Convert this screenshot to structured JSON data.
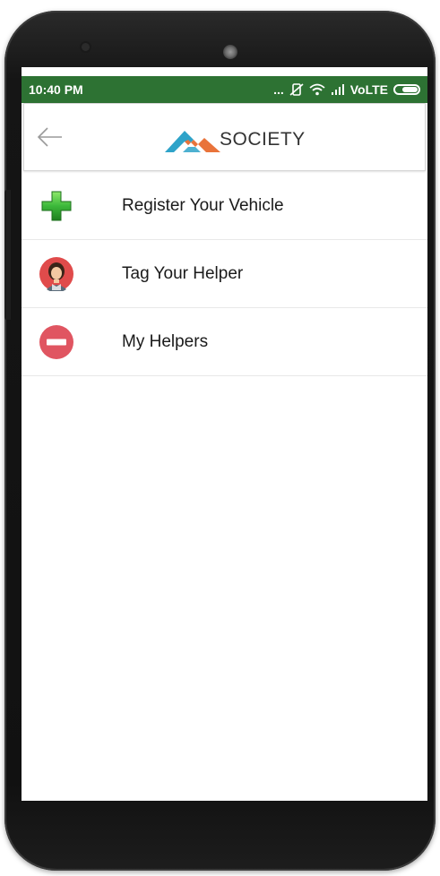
{
  "status_bar": {
    "time": "10:40 PM",
    "dots": "...",
    "network": "VoLTE",
    "color": "#2d7233"
  },
  "header": {
    "back_icon": "arrow-left-icon",
    "logo_text": "SOCIETY",
    "logo_icon": "roof-logo-icon",
    "logo_colors": {
      "left": "#2ea3c9",
      "right": "#e9733a"
    }
  },
  "menu": {
    "items": [
      {
        "label": "Register Your Vehicle",
        "icon": "green-plus-icon"
      },
      {
        "label": "Tag Your Helper",
        "icon": "helper-avatar-icon"
      },
      {
        "label": "My Helpers",
        "icon": "red-minus-icon"
      }
    ]
  }
}
